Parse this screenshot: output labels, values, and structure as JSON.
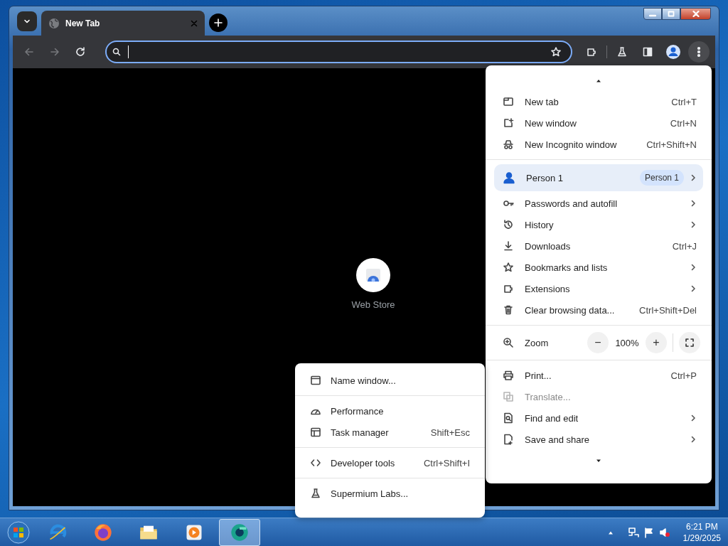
{
  "browser": {
    "tab": {
      "title": "New Tab",
      "selected": true
    },
    "toolbar": {
      "back_disabled": true,
      "forward_disabled": true
    },
    "shortcut": {
      "label": "Web Store"
    },
    "menu": {
      "items": [
        {
          "kind": "item",
          "label": "New tab",
          "shortcut": "Ctrl+T",
          "submenu": false,
          "disabled": false
        },
        {
          "kind": "item",
          "label": "New window",
          "shortcut": "Ctrl+N",
          "submenu": false,
          "disabled": false
        },
        {
          "kind": "item",
          "label": "New Incognito window",
          "shortcut": "Ctrl+Shift+N",
          "submenu": false,
          "disabled": false
        },
        {
          "kind": "separator"
        },
        {
          "kind": "profile",
          "label": "Person 1",
          "badge": "Person 1",
          "submenu": true,
          "selected": true
        },
        {
          "kind": "item",
          "label": "Passwords and autofill",
          "submenu": true,
          "disabled": false
        },
        {
          "kind": "item",
          "label": "History",
          "submenu": true,
          "disabled": false
        },
        {
          "kind": "item",
          "label": "Downloads",
          "shortcut": "Ctrl+J",
          "submenu": false,
          "disabled": false
        },
        {
          "kind": "item",
          "label": "Bookmarks and lists",
          "submenu": true,
          "disabled": false
        },
        {
          "kind": "item",
          "label": "Extensions",
          "submenu": true,
          "disabled": false
        },
        {
          "kind": "item",
          "label": "Clear browsing data...",
          "shortcut": "Ctrl+Shift+Del",
          "submenu": false,
          "disabled": false
        },
        {
          "kind": "separator"
        },
        {
          "kind": "zoom",
          "label": "Zoom",
          "minus": "−",
          "value": "100%",
          "plus": "+"
        },
        {
          "kind": "separator"
        },
        {
          "kind": "item",
          "label": "Print...",
          "shortcut": "Ctrl+P",
          "submenu": false,
          "disabled": false
        },
        {
          "kind": "item",
          "label": "Translate...",
          "submenu": false,
          "disabled": true
        },
        {
          "kind": "item",
          "label": "Find and edit",
          "submenu": true,
          "disabled": false
        },
        {
          "kind": "item",
          "label": "Save and share",
          "submenu": true,
          "disabled": false
        }
      ]
    },
    "submenu": {
      "items": [
        {
          "kind": "item",
          "label": "Name window...",
          "disabled": false
        },
        {
          "kind": "separator"
        },
        {
          "kind": "item",
          "label": "Performance",
          "disabled": false
        },
        {
          "kind": "item",
          "label": "Task manager",
          "shortcut": "Shift+Esc",
          "disabled": false
        },
        {
          "kind": "separator"
        },
        {
          "kind": "item",
          "label": "Developer tools",
          "shortcut": "Ctrl+Shift+I",
          "disabled": false
        },
        {
          "kind": "separator"
        },
        {
          "kind": "item",
          "label": "Supermium Labs...",
          "disabled": false
        }
      ]
    }
  },
  "taskbar": {
    "apps": [
      {
        "selected": false
      },
      {
        "selected": false
      },
      {
        "selected": false
      },
      {
        "selected": false
      },
      {
        "selected": true
      }
    ],
    "clock": {
      "time": "6:21 PM",
      "date": "1/29/2025"
    }
  }
}
